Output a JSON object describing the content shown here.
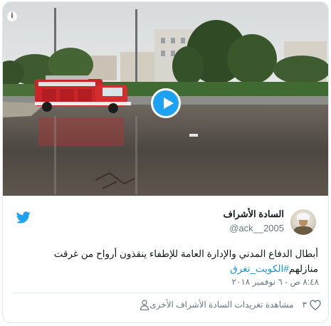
{
  "tweet": {
    "display_name": "السادة الأشراف",
    "handle": "@ack__2005",
    "text_main": "أبطال الدفاع المدني والإدارة العامة للإطفاء ينقذون أرواح من غرقت منازلهم",
    "hashtag": "#الكويت_تغرق",
    "timestamp": "٨:٤٨ ص - ٦ نوفمبر ٢٠١٨",
    "like_count": "٣",
    "more_tweets_label": "مشاهدة تغريدات السادة الأشراف الأخرى"
  },
  "media": {
    "type": "video",
    "play_icon": "play-icon",
    "info_icon": "info-icon"
  },
  "icons": {
    "brand": "twitter-bird-icon",
    "like": "heart-icon",
    "profile": "person-icon"
  },
  "colors": {
    "accent": "#1da1f2",
    "hashtag": "#1b95e0",
    "secondary_text": "#657786",
    "primary_text": "#14171a"
  }
}
